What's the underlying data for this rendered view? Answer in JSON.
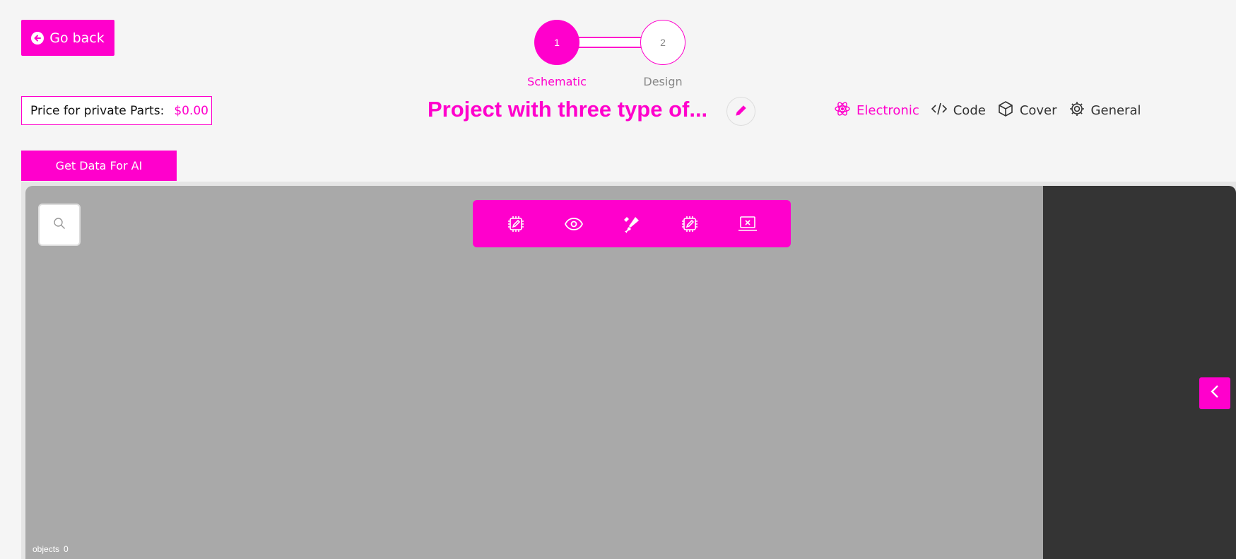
{
  "header": {
    "go_back_label": "Go back",
    "price_label": "Price for private Parts:",
    "price_value": "$0.00",
    "ai_button_label": "Get Data For AI"
  },
  "stepper": {
    "steps": [
      {
        "number": "1",
        "label": "Schematic",
        "active": true
      },
      {
        "number": "2",
        "label": "Design",
        "active": false
      }
    ]
  },
  "project": {
    "title": "Project with three type of..."
  },
  "tabs": [
    {
      "label": "Electronic",
      "icon": "atom-icon",
      "active": true
    },
    {
      "label": "Code",
      "icon": "code-icon",
      "active": false
    },
    {
      "label": "Cover",
      "icon": "cube-icon",
      "active": false
    },
    {
      "label": "General",
      "icon": "gear-icon",
      "active": false
    }
  ],
  "toolbar": {
    "tools": [
      "chip-edit-icon",
      "eye-icon",
      "paint-brush-icon",
      "chip-edit-icon",
      "laptop-icon"
    ]
  },
  "canvas": {
    "objects_label": "objects",
    "objects_count": "0"
  },
  "colors": {
    "accent": "#ff00cc",
    "canvas": "#a9a9a9",
    "side_panel": "#343434",
    "background": "#f5f5f5"
  }
}
